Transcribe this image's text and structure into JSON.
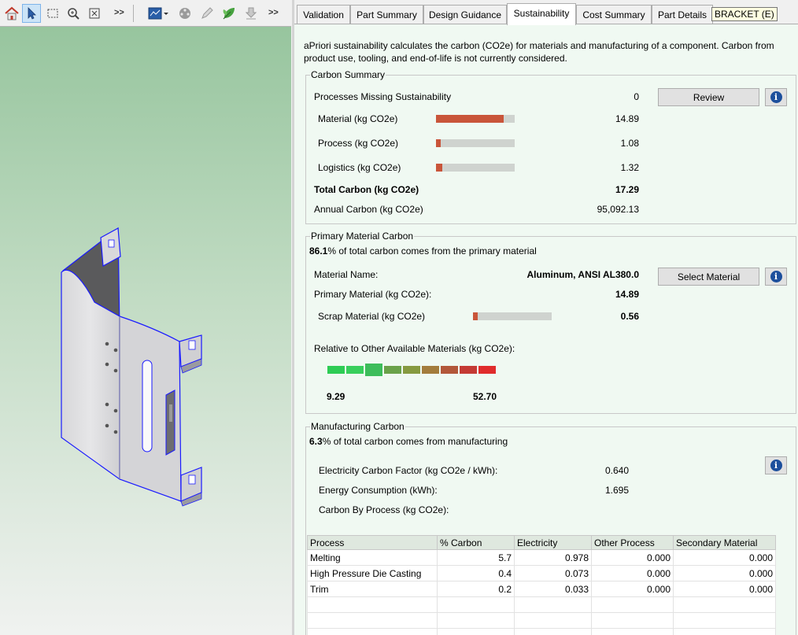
{
  "tabs": [
    {
      "label": "Validation",
      "active": false
    },
    {
      "label": "Part Summary",
      "active": false
    },
    {
      "label": "Design Guidance",
      "active": false
    },
    {
      "label": "Sustainability",
      "active": true
    },
    {
      "label": "Cost Summary",
      "active": false
    },
    {
      "label": "Part Details",
      "active": false
    }
  ],
  "tooltip": "BRACKET (E)",
  "toolbar": {
    "more_label_1": ">>",
    "more_label_2": ">>",
    "icons": [
      "home-icon",
      "select-arrow-icon",
      "box-select-icon",
      "zoom-icon",
      "fit-view-icon",
      "display-mode-icon",
      "explode-icon",
      "pen-icon",
      "sustainability-leaf-icon",
      "download-icon"
    ]
  },
  "intro_text": "aPriori sustainability calculates the carbon (CO2e) for materials and manufacturing of a component. Carbon from product use, tooling, and end-of-life is not currently considered.",
  "carbon_summary": {
    "legend": "Carbon Summary",
    "missing_label": "Processes Missing Sustainability",
    "missing_value": "0",
    "review_button": "Review",
    "material_label": "Material (kg CO2e)",
    "material_value": "14.89",
    "material_fraction": 0.861,
    "process_label": "Process (kg CO2e)",
    "process_value": "1.08",
    "process_fraction": 0.062,
    "logistics_label": "Logistics (kg CO2e)",
    "logistics_value": "1.32",
    "logistics_fraction": 0.076,
    "total_label": "Total Carbon (kg CO2e)",
    "total_value": "17.29",
    "annual_label": "Annual Carbon (kg CO2e)",
    "annual_value": "95,092.13"
  },
  "primary_material": {
    "legend": "Primary Material Carbon",
    "percent": "86.1",
    "percent_suffix": "% of total carbon comes from the primary material",
    "name_label": "Material Name:",
    "name_value": "Aluminum, ANSI AL380.0",
    "select_button": "Select Material",
    "primary_label": "Primary Material (kg CO2e):",
    "primary_value": "14.89",
    "scrap_label": "Scrap Material (kg CO2e)",
    "scrap_value": "0.56",
    "scrap_fraction": 0.036,
    "relative_label": "Relative to Other Available Materials (kg CO2e):",
    "scale_min": "9.29",
    "scale_max": "52.70",
    "scale_colors": [
      "#2ecc55",
      "#38cf5c",
      "#3dbd5b",
      "#6aa24a",
      "#869a40",
      "#a37c3c",
      "#b2573a",
      "#c43a34",
      "#e02c2c"
    ],
    "scale_selected_index": 2
  },
  "manufacturing": {
    "legend": "Manufacturing Carbon",
    "percent": "6.3",
    "percent_suffix": "% of total carbon comes from manufacturing",
    "electricity_label": "Electricity Carbon Factor (kg CO2e / kWh):",
    "electricity_value": "0.640",
    "energy_label": "Energy Consumption (kWh):",
    "energy_value": "1.695",
    "by_process_label": "Carbon By Process (kg CO2e):",
    "table": {
      "headers": [
        "Process",
        "% Carbon",
        "Electricity",
        "Other Process",
        "Secondary Material"
      ],
      "rows": [
        [
          "Melting",
          "5.7",
          "0.978",
          "0.000",
          "0.000"
        ],
        [
          "High Pressure Die Casting",
          "0.4",
          "0.073",
          "0.000",
          "0.000"
        ],
        [
          "Trim",
          "0.2",
          "0.033",
          "0.000",
          "0.000"
        ]
      ]
    }
  },
  "colors": {
    "bar_fill": "#c9553a",
    "bar_track": "#cfd3cf",
    "content_bg": "#f0f9f2",
    "info_blue": "#1c4f9c"
  }
}
